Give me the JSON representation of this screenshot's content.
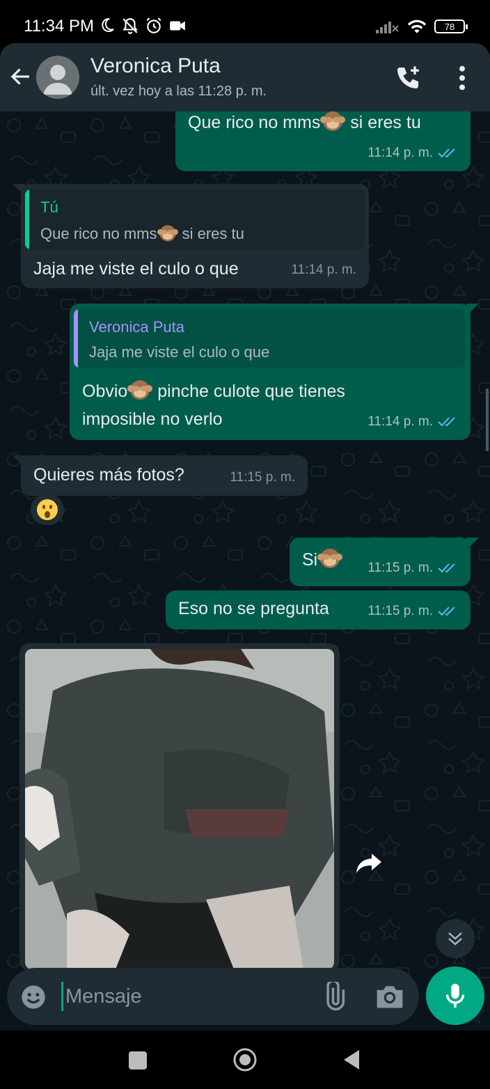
{
  "status_bar": {
    "time": "11:34 PM",
    "battery": "78",
    "icons_left": [
      "moon-icon",
      "bell-off-icon",
      "alarm-icon",
      "video-icon"
    ],
    "icons_right": [
      "signal-icon",
      "wifi-icon",
      "battery-icon"
    ]
  },
  "header": {
    "contact_name": "Veronica Puta",
    "last_seen": "últ. vez hoy a las 11:28 p. m.",
    "icons": [
      "back-arrow-icon",
      "avatar-icon",
      "add-call-icon",
      "more-vert-icon"
    ]
  },
  "messages": [
    {
      "id": "m1",
      "direction": "out",
      "text_before": "Que rico no mms",
      "emoji": "see-no-evil-monkey",
      "text_after": " si eres tu",
      "time": "11:14 p. m.",
      "status": "read"
    },
    {
      "id": "m2",
      "direction": "in",
      "quote_author": "Tú",
      "quote_text_before": "Que rico no mms",
      "quote_emoji": "see-no-evil-monkey",
      "quote_text_after": " si eres tu",
      "text": "Jaja me viste el culo o que",
      "time": "11:14 p. m."
    },
    {
      "id": "m3",
      "direction": "out",
      "quote_author": "Veronica Puta",
      "quote_text": "Jaja me viste el culo o que",
      "text_line1_before": "Obvio",
      "emoji": "see-no-evil-monkey",
      "text_line1_after": " pinche culote que tienes",
      "text_line2": "imposible no verlo",
      "time": "11:14 p. m.",
      "status": "read"
    },
    {
      "id": "m4",
      "direction": "in",
      "text": "Quieres más fotos?",
      "time": "11:15 p. m.",
      "reaction": "astonished-face"
    },
    {
      "id": "m5",
      "direction": "out",
      "text": "Si",
      "emoji": "see-no-evil-monkey",
      "time": "11:15 p. m.",
      "status": "read"
    },
    {
      "id": "m6",
      "direction": "out",
      "text": "Eso no se pregunta",
      "time": "11:15 p. m.",
      "status": "read"
    },
    {
      "id": "m7",
      "direction": "in",
      "type": "image",
      "image": "photo"
    }
  ],
  "input": {
    "placeholder": "Mensaje"
  },
  "colors": {
    "header_bg": "#1f2c34",
    "chat_bg": "#0b141a",
    "outgoing_bubble": "#005c4b",
    "incoming_bubble": "#1f2c34",
    "accent": "#00a884",
    "read_ticks": "#53bdeb",
    "quote_you": "#06cf9c",
    "quote_contact": "#a791ff"
  }
}
